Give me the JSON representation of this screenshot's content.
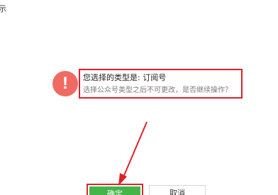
{
  "page": {
    "corner_text": "示"
  },
  "alert": {
    "icon": "alert-icon",
    "icon_symbol": "!",
    "title": "您选择的类型是: 订阅号",
    "description": "选择公众号类型之后不可更改，是否继续操作？"
  },
  "actions": {
    "confirm_label": "确定",
    "cancel_label": "取消"
  },
  "colors": {
    "alert_icon_bg": "#f06a64",
    "highlight_border": "#e02028",
    "confirm_bg": "#44b549",
    "cancel_border": "#d7d7d7"
  }
}
